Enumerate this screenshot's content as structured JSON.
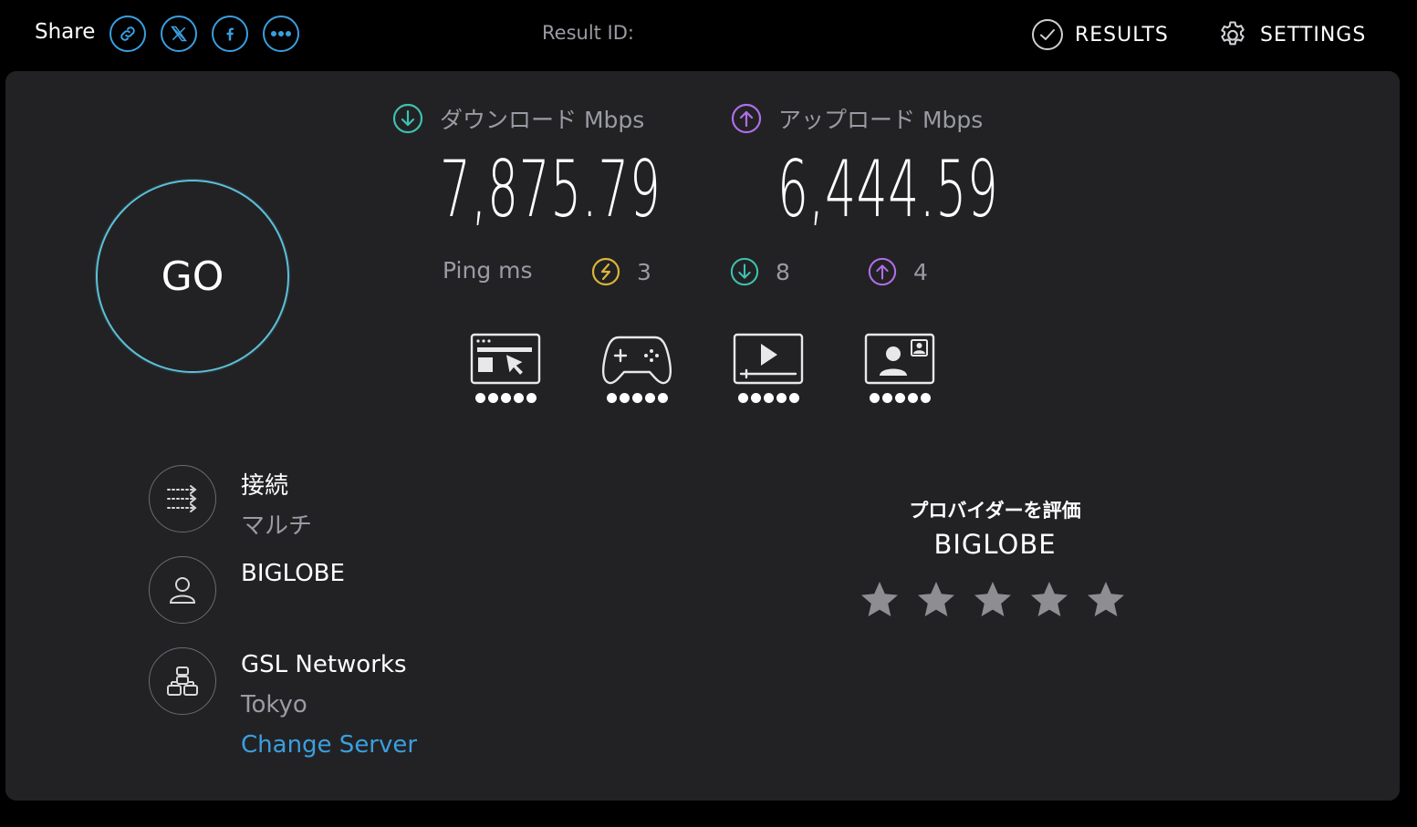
{
  "header": {
    "share_label": "Share",
    "share_buttons": [
      {
        "name": "link-icon"
      },
      {
        "name": "x-twitter-icon"
      },
      {
        "name": "facebook-icon"
      },
      {
        "name": "more-icon"
      }
    ],
    "result_id_label": "Result ID:",
    "results_label": "RESULTS",
    "settings_label": "SETTINGS"
  },
  "go_label": "GO",
  "download": {
    "label": "ダウンロード Mbps",
    "value": "7,875.79",
    "color": "#3ec1b2"
  },
  "upload": {
    "label": "アップロード Mbps",
    "value": "6,444.59",
    "color": "#b06ee8"
  },
  "ping": {
    "label": "Ping ms",
    "idle": "3",
    "download": "8",
    "upload": "4",
    "idle_color": "#d9b53a"
  },
  "apps": [
    {
      "name": "web-browsing-icon",
      "rating": 5
    },
    {
      "name": "gaming-icon",
      "rating": 5
    },
    {
      "name": "video-streaming-icon",
      "rating": 5
    },
    {
      "name": "video-chat-icon",
      "rating": 5
    }
  ],
  "connection": {
    "label": "接続",
    "value": "マルチ"
  },
  "isp": {
    "name": "BIGLOBE"
  },
  "server": {
    "name": "GSL Networks",
    "location": "Tokyo",
    "change_label": "Change Server"
  },
  "rating": {
    "title": "プロバイダーを評価",
    "isp": "BIGLOBE",
    "stars": 5
  },
  "colors": {
    "accent_blue": "#3a9fe0",
    "go_ring": "#5cc0d8"
  }
}
